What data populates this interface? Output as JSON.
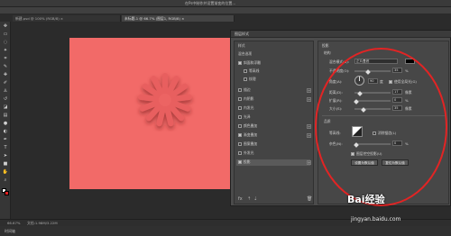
{
  "window_title": "在Ps中制作并设置渐变的位置...",
  "tabs": [
    {
      "label": "新建.psd @ 100% (RGB/8) ×"
    },
    {
      "label": "未标题-1 @ 66.7% (图层1, RGB/8) ×"
    }
  ],
  "toolbar_icons": [
    "move-icon",
    "marquee-icon",
    "lasso-icon",
    "magic-wand-icon",
    "crop-icon",
    "eyedropper-icon",
    "healing-icon",
    "brush-icon",
    "stamp-icon",
    "history-brush-icon",
    "eraser-icon",
    "gradient-icon",
    "blur-icon",
    "dodge-icon",
    "pen-icon",
    "text-icon",
    "path-select-icon",
    "shape-icon",
    "hand-icon",
    "zoom-icon"
  ],
  "status": {
    "zoom": "66.67%",
    "doc": "文档:1.98M/3.22M"
  },
  "bottom_tab": "时间轴",
  "dialog": {
    "title": "图层样式",
    "left_panel": {
      "header": "样式",
      "subheader": "混合选项",
      "items": [
        {
          "label": "斜面和浮雕",
          "checked": true,
          "plus": false
        },
        {
          "label": "等高线",
          "checked": false,
          "plus": false
        },
        {
          "label": "纹理",
          "checked": false,
          "plus": false
        },
        {
          "label": "描边",
          "checked": false,
          "plus": true
        },
        {
          "label": "内阴影",
          "checked": false,
          "plus": true
        },
        {
          "label": "内发光",
          "checked": false,
          "plus": false
        },
        {
          "label": "光泽",
          "checked": false,
          "plus": false
        },
        {
          "label": "颜色叠加",
          "checked": false,
          "plus": true
        },
        {
          "label": "渐变叠加",
          "checked": true,
          "plus": true
        },
        {
          "label": "图案叠加",
          "checked": false,
          "plus": false
        },
        {
          "label": "外发光",
          "checked": false,
          "plus": false
        },
        {
          "label": "投影",
          "checked": true,
          "plus": true
        }
      ]
    },
    "right_panel": {
      "section": "投影",
      "structure": "结构",
      "blend_label": "混合模式(B):",
      "blend_value": "正片叠底",
      "opacity_label": "不透明度(O):",
      "opacity_value": "35",
      "angle_label": "角度(A):",
      "angle_value": "90",
      "global_light": "使用全局光(G)",
      "distance_label": "距离(D):",
      "distance_value": "17",
      "spread_label": "扩展(R):",
      "spread_value": "0",
      "size_label": "大小(S):",
      "size_value": "35",
      "unit_px": "像素",
      "unit_pct": "%",
      "unit_deg": "度",
      "quality": "品质",
      "contour_label": "等高线:",
      "antialias": "消除锯齿(L)",
      "noise_label": "杂色(N):",
      "noise_value": "0",
      "knockout": "图层挖空投影(U)",
      "btn_default": "设置为默认值",
      "btn_reset": "复位为默认值"
    }
  },
  "watermark": "Bai经验",
  "watermark_url": "jingyan.baidu.com",
  "colors": {
    "canvas": "#f26a68",
    "ring": "#e22424"
  }
}
